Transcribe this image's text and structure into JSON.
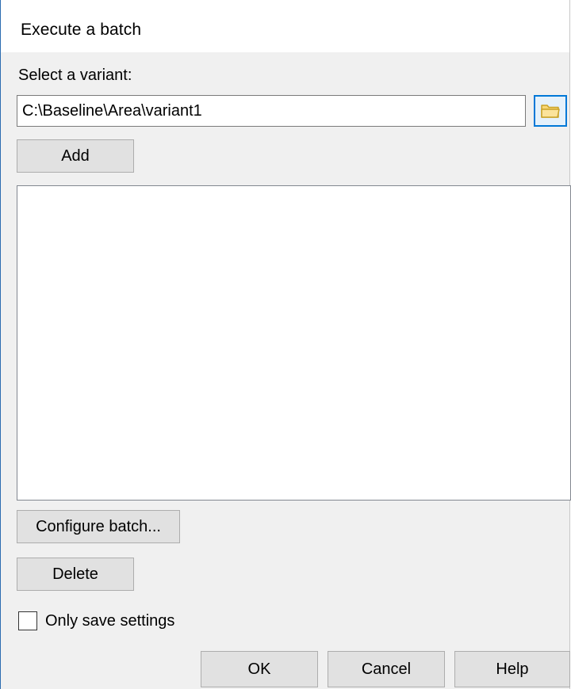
{
  "window": {
    "title": "Execute a batch"
  },
  "variant": {
    "label": "Select a variant:",
    "path_value": "C:\\Baseline\\Area\\variant1",
    "browse_icon": "folder-icon",
    "add_label": "Add"
  },
  "batch_list": {
    "items": []
  },
  "actions": {
    "configure_label": "Configure batch...",
    "delete_label": "Delete"
  },
  "options": {
    "only_save_settings_label": "Only save settings",
    "only_save_settings_checked": false
  },
  "footer": {
    "ok_label": "OK",
    "cancel_label": "Cancel",
    "help_label": "Help"
  },
  "colors": {
    "focus_border": "#0078d7",
    "folder_fill": "#f8d775",
    "folder_stroke": "#c9a227"
  }
}
